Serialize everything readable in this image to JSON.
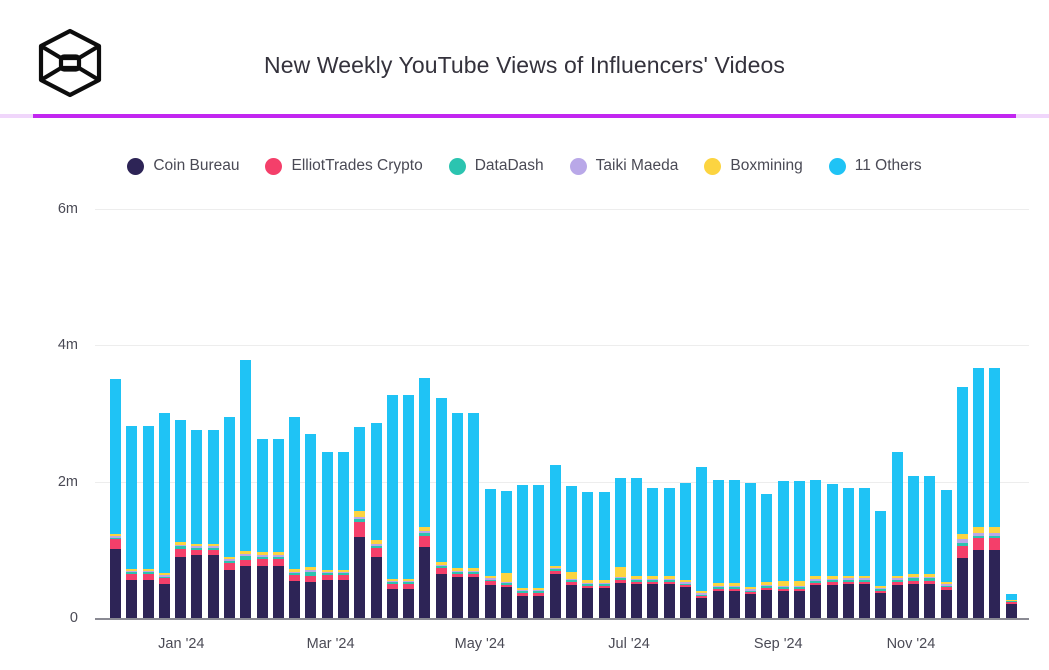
{
  "header": {
    "title": "New Weekly YouTube Views of Influencers' Videos",
    "logo_name": "hexagon-cube-logo",
    "divider_color": "#c226f0",
    "divider_track_color": "#f0d6fb"
  },
  "legend": {
    "items": [
      {
        "label": "Coin Bureau",
        "color": "#2d2456"
      },
      {
        "label": "ElliotTrades Crypto",
        "color": "#f43f6a"
      },
      {
        "label": "DataDash",
        "color": "#2bc4b0"
      },
      {
        "label": "Taiki Maeda",
        "color": "#b9a8e8"
      },
      {
        "label": "Boxmining",
        "color": "#fcd440"
      },
      {
        "label": "11 Others",
        "color": "#1fc3f5"
      }
    ]
  },
  "chart_data": {
    "type": "bar",
    "stacked": true,
    "title": "New Weekly YouTube Views of Influencers' Videos",
    "xlabel": "",
    "ylabel": "",
    "ylim": [
      0,
      6000000
    ],
    "yticks": [
      0,
      2000000,
      4000000,
      6000000
    ],
    "ytick_labels": [
      "0",
      "2m",
      "4m",
      "6m"
    ],
    "grid": true,
    "legend_position": "top",
    "xtick_labels": [
      "Jan '24",
      "Mar '24",
      "May '24",
      "Jul '24",
      "Sep '24",
      "Nov '24"
    ],
    "xtick_indices": [
      4,
      13,
      22,
      31,
      40,
      48
    ],
    "series": [
      {
        "name": "Coin Bureau",
        "color": "#2d2456",
        "values": [
          1010000,
          560000,
          500000,
          890000,
          930000,
          700000,
          760000,
          760000,
          540000,
          530000,
          560000,
          1190000,
          900000,
          430000,
          1040000,
          640000,
          600000,
          480000,
          450000,
          330000,
          640000,
          480000,
          440000,
          520000,
          500000,
          500000,
          450000,
          300000,
          400000,
          350000,
          410000,
          400000,
          480000,
          490000,
          500000,
          370000,
          480000,
          500000,
          410000,
          880000,
          1000000,
          200000
        ]
      },
      {
        "name": "ElliotTrades Crypto",
        "color": "#f43f6a",
        "values": [
          145000,
          90000,
          80000,
          125000,
          70000,
          105000,
          90000,
          100000,
          85000,
          80000,
          70000,
          220000,
          120000,
          70000,
          160000,
          90000,
          50000,
          60000,
          40000,
          40000,
          50000,
          50000,
          35000,
          35000,
          30000,
          30000,
          30000,
          25000,
          30000,
          25000,
          35000,
          30000,
          35000,
          40000,
          35000,
          30000,
          45000,
          50000,
          40000,
          180000,
          170000,
          30000
        ]
      },
      {
        "name": "DataDash",
        "color": "#2bc4b0",
        "values": [
          25000,
          25000,
          25000,
          35000,
          30000,
          30000,
          60000,
          40000,
          30000,
          60000,
          30000,
          45000,
          40000,
          25000,
          40000,
          30000,
          25000,
          25000,
          25000,
          25000,
          25000,
          25000,
          25000,
          25000,
          25000,
          25000,
          25000,
          20000,
          25000,
          25000,
          25000,
          25000,
          30000,
          25000,
          25000,
          25000,
          30000,
          30000,
          25000,
          40000,
          35000,
          15000
        ]
      },
      {
        "name": "Taiki Maeda",
        "color": "#b9a8e8",
        "values": [
          20000,
          20000,
          20000,
          25000,
          20000,
          25000,
          35000,
          25000,
          25000,
          35000,
          20000,
          30000,
          25000,
          20000,
          30000,
          20000,
          20000,
          20000,
          20000,
          20000,
          20000,
          20000,
          20000,
          20000,
          20000,
          20000,
          20000,
          15000,
          20000,
          20000,
          20000,
          20000,
          25000,
          20000,
          20000,
          20000,
          25000,
          25000,
          20000,
          65000,
          40000,
          10000
        ]
      },
      {
        "name": "Boxmining",
        "color": "#fcd440",
        "values": [
          35000,
          30000,
          30000,
          40000,
          35000,
          40000,
          45000,
          40000,
          35000,
          40000,
          30000,
          80000,
          55000,
          30000,
          60000,
          40000,
          35000,
          35000,
          130000,
          30000,
          35000,
          100000,
          35000,
          150000,
          35000,
          35000,
          30000,
          30000,
          40000,
          30000,
          35000,
          70000,
          40000,
          35000,
          35000,
          30000,
          40000,
          40000,
          35000,
          70000,
          90000,
          15000
        ]
      },
      {
        "name": "11 Others",
        "color": "#1fc3f5",
        "values": [
          2270000,
          2090000,
          2350000,
          1790000,
          1670000,
          2050000,
          2790000,
          1660000,
          2240000,
          1960000,
          1720000,
          1240000,
          1720000,
          2690000,
          2190000,
          2410000,
          2280000,
          1280000,
          1200000,
          1500000,
          1470000,
          1260000,
          1300000,
          1310000,
          1440000,
          1300000,
          1420000,
          1830000,
          1510000,
          1530000,
          1290000,
          1470000,
          1420000,
          1360000,
          1290000,
          1100000,
          1820000,
          1440000,
          1350000,
          2150000,
          2340000,
          80000
        ]
      }
    ],
    "bar_count": 56,
    "total_peak": 4700000
  }
}
